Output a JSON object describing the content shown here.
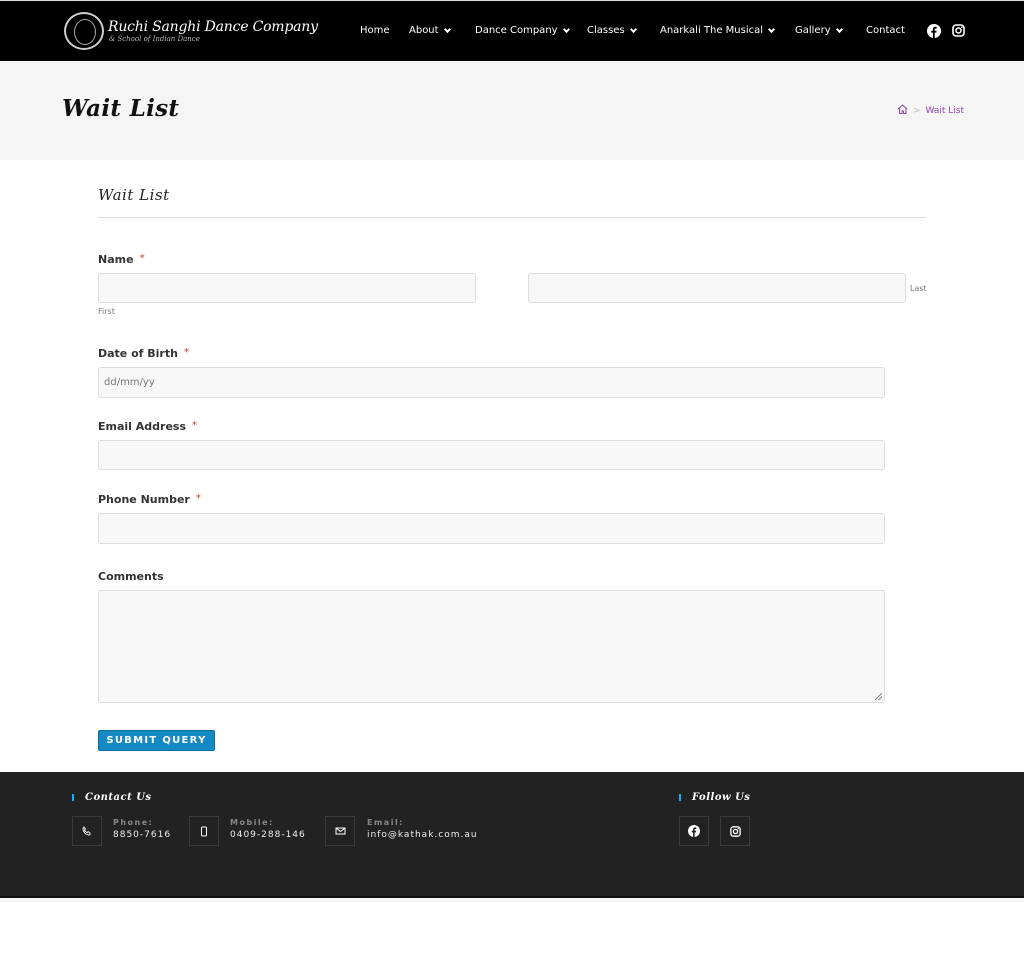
{
  "header": {
    "logo_title": "Ruchi Sanghi Dance Company",
    "logo_subtitle": "& School of Indian Dance",
    "nav": [
      {
        "label": "Home",
        "has_dropdown": false
      },
      {
        "label": "About",
        "has_dropdown": true
      },
      {
        "label": "Dance Company",
        "has_dropdown": true
      },
      {
        "label": "Classes",
        "has_dropdown": true
      },
      {
        "label": "Anarkali The Musical",
        "has_dropdown": true
      },
      {
        "label": "Gallery",
        "has_dropdown": true
      },
      {
        "label": "Contact",
        "has_dropdown": false
      }
    ],
    "social": [
      "facebook-icon",
      "instagram-icon"
    ]
  },
  "page_header": {
    "title": "Wait List",
    "breadcrumb": {
      "home_icon": "home-icon",
      "separator": ">",
      "current": "Wait List"
    }
  },
  "form": {
    "title": "Wait List",
    "required_marker": "*",
    "fields": {
      "name": {
        "label": "Name",
        "required": true,
        "first_sublabel": "First",
        "last_sublabel": "Last",
        "first_value": "",
        "last_value": ""
      },
      "dob": {
        "label": "Date of Birth",
        "required": true,
        "placeholder": "dd/mm/yy",
        "value": ""
      },
      "email": {
        "label": "Email Address",
        "required": true,
        "value": ""
      },
      "phone": {
        "label": "Phone Number",
        "required": true,
        "value": ""
      },
      "comments": {
        "label": "Comments",
        "required": false,
        "value": ""
      }
    },
    "submit_label": "SUBMIT QUERY"
  },
  "footer": {
    "contact_heading": "Contact Us",
    "follow_heading": "Follow Us",
    "contacts": [
      {
        "icon": "phone-icon",
        "label": "Phone:",
        "value": "8850-7616"
      },
      {
        "icon": "mobile-icon",
        "label": "Mobile:",
        "value": "0409-288-146"
      },
      {
        "icon": "envelope-icon",
        "label": "Email:",
        "value": "info@kathak.com.au"
      }
    ],
    "social": [
      "facebook-icon",
      "instagram-icon"
    ]
  },
  "colors": {
    "accent": "#1489c4",
    "breadcrumb": "#8e44ad",
    "footer_bg": "#222222",
    "heading_bar": "#13aff0",
    "required": "#c0392b"
  }
}
